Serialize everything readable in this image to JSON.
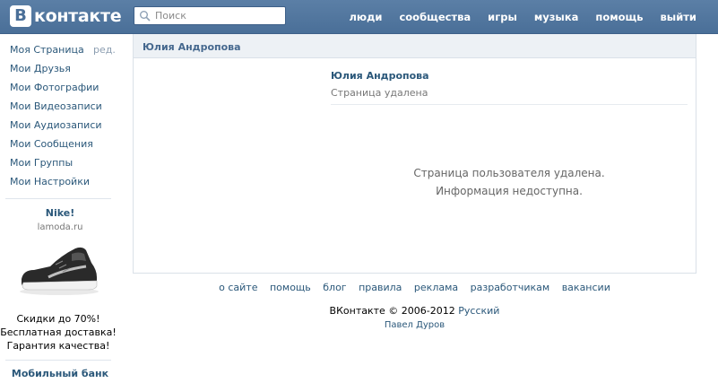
{
  "header": {
    "logo_letter": "В",
    "logo_text": "контакте",
    "search_placeholder": "Поиск",
    "nav": [
      "люди",
      "сообщества",
      "игры",
      "музыка",
      "помощь",
      "выйти"
    ]
  },
  "sidebar": {
    "items": [
      {
        "label": "Моя Страница",
        "edit": "ред."
      },
      {
        "label": "Мои Друзья"
      },
      {
        "label": "Мои Фотографии"
      },
      {
        "label": "Мои Видеозаписи"
      },
      {
        "label": "Мои Аудиозаписи"
      },
      {
        "label": "Мои Сообщения"
      },
      {
        "label": "Мои Группы"
      },
      {
        "label": "Мои Настройки"
      }
    ],
    "ad": {
      "title": "Nike!",
      "subtitle": "lamoda.ru",
      "lines": [
        "Скидки до 70%!",
        "Бесплатная доставка!",
        "Гарантия качества!"
      ],
      "next_ad_title": "Мобильный банк"
    }
  },
  "main": {
    "header_title": "Юлия Андропова",
    "profile_name": "Юлия Андропова",
    "profile_status": "Страница удалена",
    "message_line1": "Страница пользователя удалена.",
    "message_line2": "Информация недоступна."
  },
  "footer": {
    "links": [
      "о сайте",
      "помощь",
      "блог",
      "правила",
      "реклама",
      "разработчикам",
      "вакансии"
    ],
    "copyright": "ВКонтакте © 2006-2012",
    "language": "Русский",
    "author": "Павел Дуров"
  },
  "colors": {
    "header_bg": "#4a6f98",
    "link": "#2b587a",
    "panel_header_bg": "#edf1f5"
  }
}
